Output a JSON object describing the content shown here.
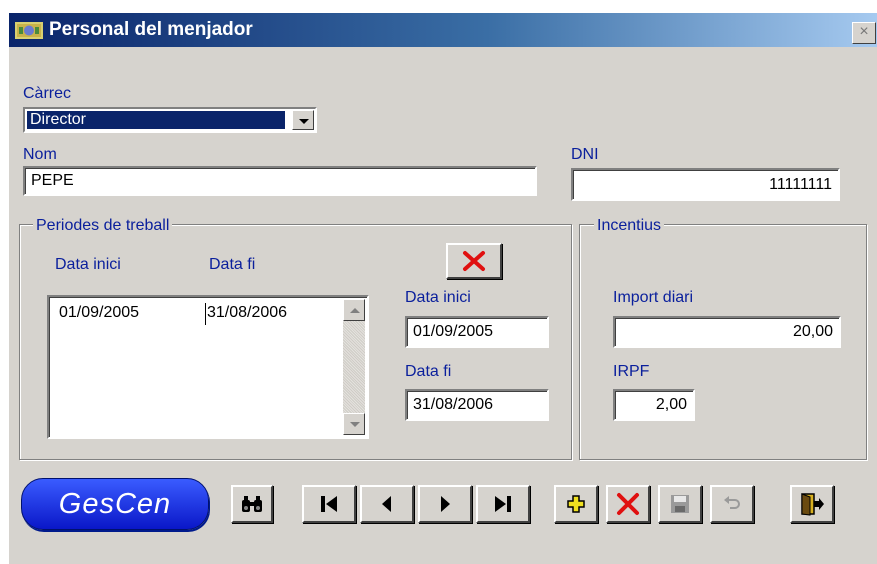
{
  "window": {
    "title": "Personal del menjador",
    "close_glyph": "×"
  },
  "form": {
    "carrec": {
      "label": "Càrrec",
      "value": "Director"
    },
    "nom": {
      "label": "Nom",
      "value": "PEPE"
    },
    "dni": {
      "label": "DNI",
      "value": "11111111"
    }
  },
  "periodes": {
    "title": "Periodes de treball",
    "columns": [
      "Data inici",
      "Data fi"
    ],
    "rows": [
      {
        "inici": "01/09/2005",
        "fi": "31/08/2006"
      }
    ],
    "data_inici_label": "Data inici",
    "data_inici_value": "01/09/2005",
    "data_fi_label": "Data fi",
    "data_fi_value": "31/08/2006"
  },
  "incentius": {
    "title": "Incentius",
    "import_label": "Import diari",
    "import_value": "20,00",
    "irpf_label": "IRPF",
    "irpf_value": "2,00"
  },
  "logo_text": "GesCen",
  "toolbar": [
    "binoculars-icon",
    "first-record-icon",
    "prev-record-icon",
    "next-record-icon",
    "last-record-icon",
    "add-icon",
    "delete-icon",
    "save-icon",
    "undo-icon",
    "exit-icon"
  ],
  "colors": {
    "label": "#0a1f9c",
    "title_bar": "#0a246a",
    "face": "#d6d3ce",
    "delete_red": "#e01010",
    "logo_blue": "#1428e0"
  }
}
